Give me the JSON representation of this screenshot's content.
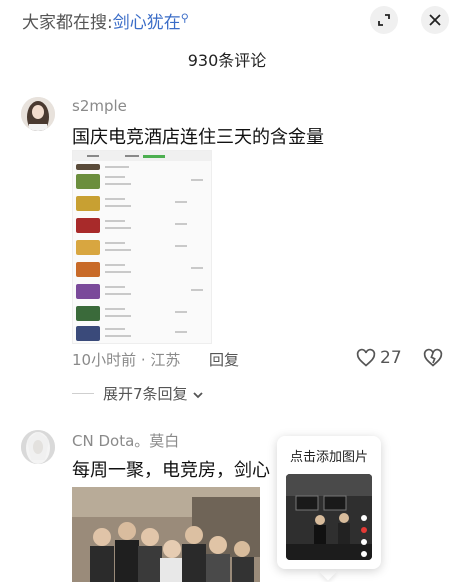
{
  "header": {
    "search_prefix": "大家都在搜:",
    "search_keyword": "剑心犹在",
    "comment_count": "930条评论"
  },
  "comments": [
    {
      "username": "s2mple",
      "text": "国庆电竞酒店连住三天的含金量",
      "meta": "10小时前 · 江苏",
      "reply_label": "回复",
      "like_count": "27",
      "expand_label": "展开7条回复"
    },
    {
      "username": "CN Dota。莫白",
      "text": "每周一聚，电竞房，剑心"
    }
  ],
  "tooltip": {
    "title": "点击添加图片"
  },
  "colors": {
    "accent": "#3a6cc7",
    "muted": "#8a8a8a"
  },
  "icons": [
    "search-icon",
    "collapse-icon",
    "close-icon",
    "heart-icon",
    "dislike-icon",
    "chevron-down-icon"
  ]
}
